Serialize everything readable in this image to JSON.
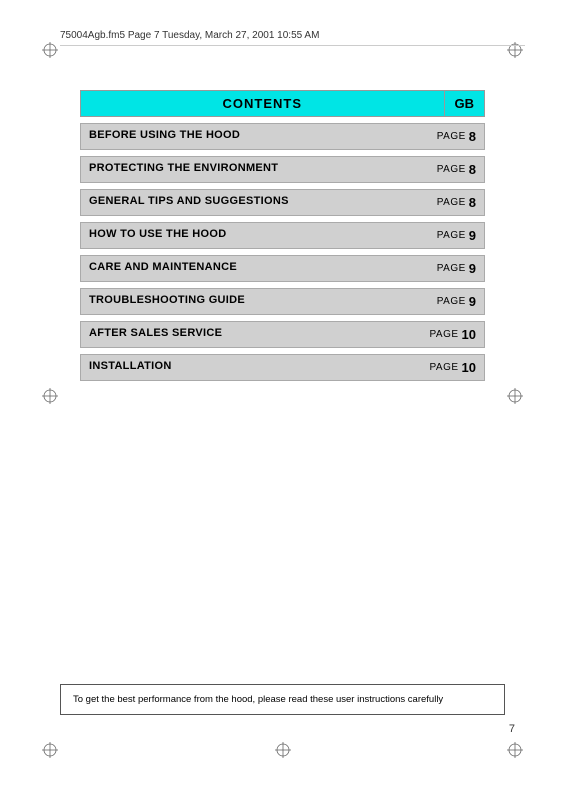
{
  "header": {
    "file_info": "75004Agb.fm5  Page 7  Tuesday, March 27, 2001  10:55 AM"
  },
  "contents": {
    "title": "CONTENTS",
    "gb_label": "GB",
    "rows": [
      {
        "label": "BEFORE USING THE HOOD",
        "page_word": "PAGE",
        "page_num": "8"
      },
      {
        "label": "PROTECTING THE ENVIRONMENT",
        "page_word": "PAGE",
        "page_num": "8"
      },
      {
        "label": "GENERAL TIPS AND SUGGESTIONS",
        "page_word": "PAGE",
        "page_num": "8"
      },
      {
        "label": "HOW TO USE THE HOOD",
        "page_word": "PAGE",
        "page_num": "9"
      },
      {
        "label": "CARE AND MAINTENANCE",
        "page_word": "PAGE",
        "page_num": "9"
      },
      {
        "label": "TROUBLESHOOTING GUIDE",
        "page_word": "PAGE",
        "page_num": "9"
      },
      {
        "label": "AFTER SALES SERVICE",
        "page_word": "PAGE",
        "page_num": "10"
      },
      {
        "label": "INSTALLATION",
        "page_word": "PAGE",
        "page_num": "10"
      }
    ]
  },
  "footer": {
    "note": "To get the best performance from the hood, please read these user instructions carefully"
  },
  "page_number": "7"
}
